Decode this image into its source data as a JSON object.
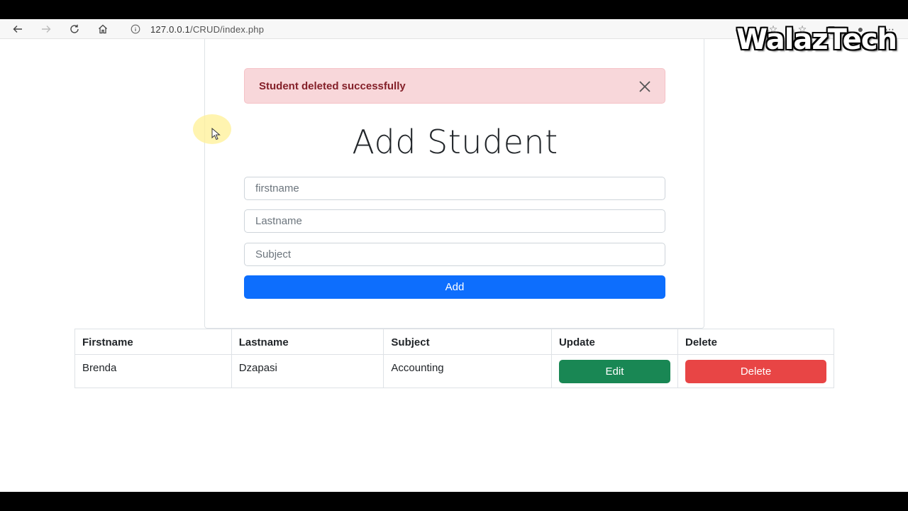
{
  "browser": {
    "url_host": "127.0.0.1",
    "url_path": "/CRUD/index.php",
    "watermark": "WalazTech"
  },
  "alert": {
    "message": "Student deleted successfully"
  },
  "form": {
    "title": "Add Student",
    "firstname_placeholder": "firstname",
    "lastname_placeholder": "Lastname",
    "subject_placeholder": "Subject",
    "add_label": "Add"
  },
  "table": {
    "headers": [
      "Firstname",
      "Lastname",
      "Subject",
      "Update",
      "Delete"
    ],
    "rows": [
      {
        "firstname": "Brenda",
        "lastname": "Dzapasi",
        "subject": "Accounting",
        "edit_label": "Edit",
        "delete_label": "Delete"
      }
    ]
  },
  "colors": {
    "primary": "#0d6efd",
    "success": "#198754",
    "danger": "#e84545",
    "alert_bg": "#f8d7da",
    "alert_text": "#842029"
  }
}
